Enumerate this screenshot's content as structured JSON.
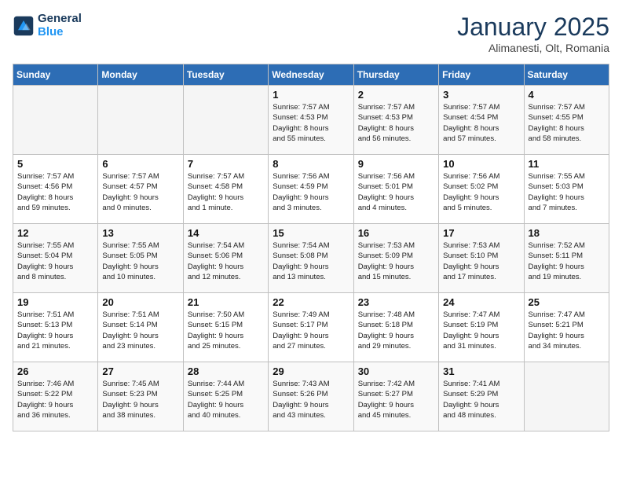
{
  "header": {
    "logo_line1": "General",
    "logo_line2": "Blue",
    "month": "January 2025",
    "location": "Alimanesti, Olt, Romania"
  },
  "weekdays": [
    "Sunday",
    "Monday",
    "Tuesday",
    "Wednesday",
    "Thursday",
    "Friday",
    "Saturday"
  ],
  "weeks": [
    [
      {
        "day": "",
        "info": ""
      },
      {
        "day": "",
        "info": ""
      },
      {
        "day": "",
        "info": ""
      },
      {
        "day": "1",
        "info": "Sunrise: 7:57 AM\nSunset: 4:53 PM\nDaylight: 8 hours\nand 55 minutes."
      },
      {
        "day": "2",
        "info": "Sunrise: 7:57 AM\nSunset: 4:53 PM\nDaylight: 8 hours\nand 56 minutes."
      },
      {
        "day": "3",
        "info": "Sunrise: 7:57 AM\nSunset: 4:54 PM\nDaylight: 8 hours\nand 57 minutes."
      },
      {
        "day": "4",
        "info": "Sunrise: 7:57 AM\nSunset: 4:55 PM\nDaylight: 8 hours\nand 58 minutes."
      }
    ],
    [
      {
        "day": "5",
        "info": "Sunrise: 7:57 AM\nSunset: 4:56 PM\nDaylight: 8 hours\nand 59 minutes."
      },
      {
        "day": "6",
        "info": "Sunrise: 7:57 AM\nSunset: 4:57 PM\nDaylight: 9 hours\nand 0 minutes."
      },
      {
        "day": "7",
        "info": "Sunrise: 7:57 AM\nSunset: 4:58 PM\nDaylight: 9 hours\nand 1 minute."
      },
      {
        "day": "8",
        "info": "Sunrise: 7:56 AM\nSunset: 4:59 PM\nDaylight: 9 hours\nand 3 minutes."
      },
      {
        "day": "9",
        "info": "Sunrise: 7:56 AM\nSunset: 5:01 PM\nDaylight: 9 hours\nand 4 minutes."
      },
      {
        "day": "10",
        "info": "Sunrise: 7:56 AM\nSunset: 5:02 PM\nDaylight: 9 hours\nand 5 minutes."
      },
      {
        "day": "11",
        "info": "Sunrise: 7:55 AM\nSunset: 5:03 PM\nDaylight: 9 hours\nand 7 minutes."
      }
    ],
    [
      {
        "day": "12",
        "info": "Sunrise: 7:55 AM\nSunset: 5:04 PM\nDaylight: 9 hours\nand 8 minutes."
      },
      {
        "day": "13",
        "info": "Sunrise: 7:55 AM\nSunset: 5:05 PM\nDaylight: 9 hours\nand 10 minutes."
      },
      {
        "day": "14",
        "info": "Sunrise: 7:54 AM\nSunset: 5:06 PM\nDaylight: 9 hours\nand 12 minutes."
      },
      {
        "day": "15",
        "info": "Sunrise: 7:54 AM\nSunset: 5:08 PM\nDaylight: 9 hours\nand 13 minutes."
      },
      {
        "day": "16",
        "info": "Sunrise: 7:53 AM\nSunset: 5:09 PM\nDaylight: 9 hours\nand 15 minutes."
      },
      {
        "day": "17",
        "info": "Sunrise: 7:53 AM\nSunset: 5:10 PM\nDaylight: 9 hours\nand 17 minutes."
      },
      {
        "day": "18",
        "info": "Sunrise: 7:52 AM\nSunset: 5:11 PM\nDaylight: 9 hours\nand 19 minutes."
      }
    ],
    [
      {
        "day": "19",
        "info": "Sunrise: 7:51 AM\nSunset: 5:13 PM\nDaylight: 9 hours\nand 21 minutes."
      },
      {
        "day": "20",
        "info": "Sunrise: 7:51 AM\nSunset: 5:14 PM\nDaylight: 9 hours\nand 23 minutes."
      },
      {
        "day": "21",
        "info": "Sunrise: 7:50 AM\nSunset: 5:15 PM\nDaylight: 9 hours\nand 25 minutes."
      },
      {
        "day": "22",
        "info": "Sunrise: 7:49 AM\nSunset: 5:17 PM\nDaylight: 9 hours\nand 27 minutes."
      },
      {
        "day": "23",
        "info": "Sunrise: 7:48 AM\nSunset: 5:18 PM\nDaylight: 9 hours\nand 29 minutes."
      },
      {
        "day": "24",
        "info": "Sunrise: 7:47 AM\nSunset: 5:19 PM\nDaylight: 9 hours\nand 31 minutes."
      },
      {
        "day": "25",
        "info": "Sunrise: 7:47 AM\nSunset: 5:21 PM\nDaylight: 9 hours\nand 34 minutes."
      }
    ],
    [
      {
        "day": "26",
        "info": "Sunrise: 7:46 AM\nSunset: 5:22 PM\nDaylight: 9 hours\nand 36 minutes."
      },
      {
        "day": "27",
        "info": "Sunrise: 7:45 AM\nSunset: 5:23 PM\nDaylight: 9 hours\nand 38 minutes."
      },
      {
        "day": "28",
        "info": "Sunrise: 7:44 AM\nSunset: 5:25 PM\nDaylight: 9 hours\nand 40 minutes."
      },
      {
        "day": "29",
        "info": "Sunrise: 7:43 AM\nSunset: 5:26 PM\nDaylight: 9 hours\nand 43 minutes."
      },
      {
        "day": "30",
        "info": "Sunrise: 7:42 AM\nSunset: 5:27 PM\nDaylight: 9 hours\nand 45 minutes."
      },
      {
        "day": "31",
        "info": "Sunrise: 7:41 AM\nSunset: 5:29 PM\nDaylight: 9 hours\nand 48 minutes."
      },
      {
        "day": "",
        "info": ""
      }
    ]
  ]
}
